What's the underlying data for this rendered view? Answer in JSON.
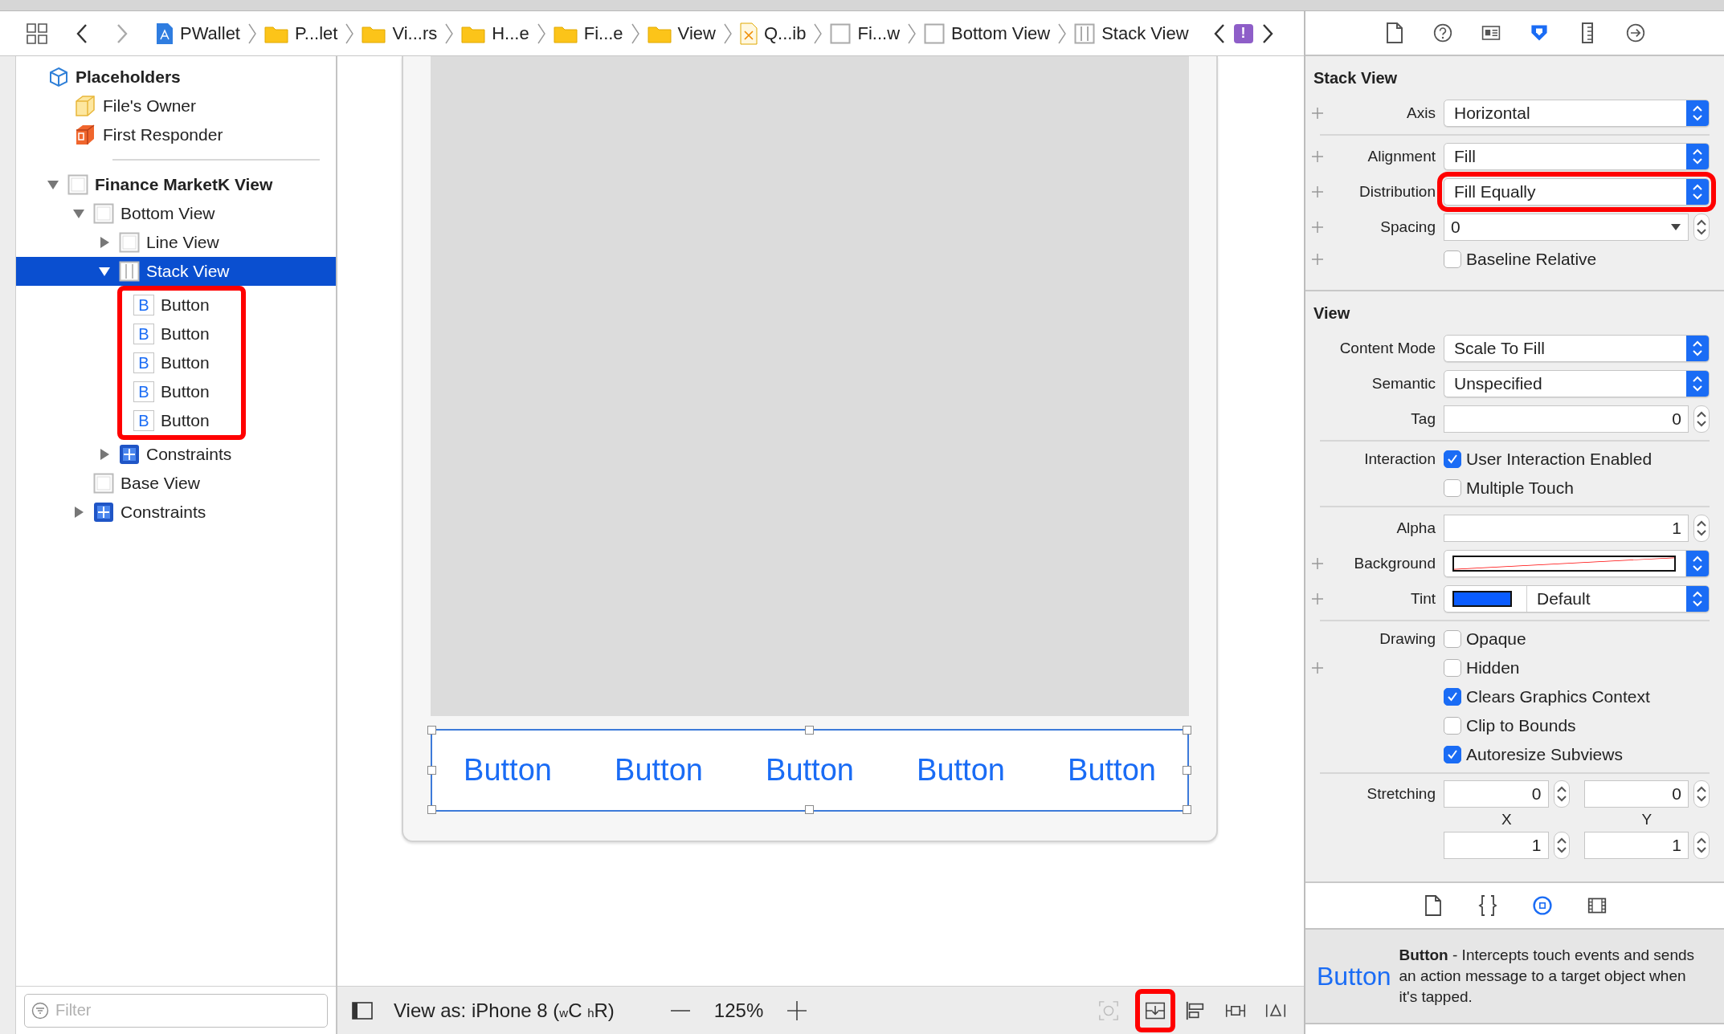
{
  "navigator": {
    "back_enabled": true,
    "forward_enabled": false
  },
  "breadcrumbs": [
    {
      "label": "PWallet",
      "kind": "project"
    },
    {
      "label": "P...let",
      "kind": "folder"
    },
    {
      "label": "Vi...rs",
      "kind": "folder"
    },
    {
      "label": "H...e",
      "kind": "folder"
    },
    {
      "label": "Fi...e",
      "kind": "folder"
    },
    {
      "label": "View",
      "kind": "folder"
    },
    {
      "label": "Q...ib",
      "kind": "xib"
    },
    {
      "label": "Fi...w",
      "kind": "view"
    },
    {
      "label": "Bottom View",
      "kind": "view"
    },
    {
      "label": "Stack View",
      "kind": "stack"
    }
  ],
  "issue_badge": "!",
  "placeholders": {
    "title": "Placeholders",
    "items": [
      {
        "label": "File's Owner",
        "kind": "owner",
        "selected": false
      },
      {
        "label": "First Responder",
        "kind": "responder",
        "selected": false
      }
    ]
  },
  "outline": [
    {
      "label": "Finance MarketK View",
      "kind": "view",
      "bold": true,
      "expanded": true,
      "selected": false,
      "children": [
        {
          "label": "Bottom View",
          "kind": "view",
          "expanded": true,
          "selected": false,
          "children": [
            {
              "label": "Line View",
              "kind": "view",
              "expanded": false,
              "selected": false
            },
            {
              "label": "Stack View",
              "kind": "stack",
              "expanded": true,
              "selected": true,
              "children_highlighted": true,
              "children": [
                {
                  "label": "Button",
                  "kind": "button",
                  "icon_text": "B",
                  "selected": false
                },
                {
                  "label": "Button",
                  "kind": "button",
                  "icon_text": "B",
                  "selected": false
                },
                {
                  "label": "Button",
                  "kind": "button",
                  "icon_text": "B",
                  "selected": false
                },
                {
                  "label": "Button",
                  "kind": "button",
                  "icon_text": "B",
                  "selected": false
                },
                {
                  "label": "Button",
                  "kind": "button",
                  "icon_text": "B",
                  "selected": false
                }
              ]
            },
            {
              "label": "Constraints",
              "kind": "constraints",
              "expanded": false,
              "selected": false
            }
          ]
        },
        {
          "label": "Base View",
          "kind": "view",
          "selected": false
        },
        {
          "label": "Constraints",
          "kind": "constraints",
          "expanded": false,
          "selected": false
        }
      ]
    }
  ],
  "filter": {
    "placeholder": "Filter"
  },
  "canvas": {
    "stack_buttons": [
      "Button",
      "Button",
      "Button",
      "Button",
      "Button"
    ]
  },
  "canvas_toolbar": {
    "view_as": "View as: iPhone 8 ($_{w}$C $_{h}$R)",
    "zoom": "125%",
    "tools": [
      {
        "kind": "update",
        "disabled": true,
        "highlighted": false
      },
      {
        "kind": "embed",
        "disabled": false,
        "highlighted": true
      },
      {
        "kind": "align",
        "disabled": false,
        "highlighted": false
      },
      {
        "kind": "pin",
        "disabled": false,
        "highlighted": false
      },
      {
        "kind": "resolve",
        "disabled": false,
        "highlighted": false
      }
    ]
  },
  "inspector_tabs": [
    {
      "kind": "file",
      "selected": false
    },
    {
      "kind": "help",
      "selected": false
    },
    {
      "kind": "identity",
      "selected": false
    },
    {
      "kind": "attributes",
      "selected": true
    },
    {
      "kind": "size",
      "selected": false
    },
    {
      "kind": "connections",
      "selected": false
    }
  ],
  "sections": [
    {
      "title": "Stack View",
      "groups": [
        [
          {
            "kind": "popup",
            "plus": true,
            "label": "Axis",
            "value": "Horizontal"
          }
        ],
        [
          {
            "kind": "popup",
            "plus": true,
            "label": "Alignment",
            "value": "Fill"
          },
          {
            "kind": "popup",
            "plus": true,
            "label": "Distribution",
            "value": "Fill Equally",
            "highlighted": true
          },
          {
            "kind": "combo",
            "plus": true,
            "label": "Spacing",
            "value": "0"
          },
          {
            "kind": "checkbox",
            "plus": true,
            "text": "Baseline Relative",
            "checked": false
          }
        ]
      ]
    },
    {
      "title": "View",
      "groups": [
        [
          {
            "kind": "popup",
            "label": "Content Mode",
            "value": "Scale To Fill"
          },
          {
            "kind": "popup",
            "label": "Semantic",
            "value": "Unspecified"
          },
          {
            "kind": "stepper",
            "label": "Tag",
            "value": "0"
          }
        ],
        [
          {
            "kind": "checkbox",
            "label": "Interaction",
            "text": "User Interaction Enabled",
            "checked": true
          },
          {
            "kind": "checkbox",
            "text": "Multiple Touch",
            "checked": false
          }
        ],
        [
          {
            "kind": "stepper",
            "label": "Alpha",
            "value": "1"
          },
          {
            "kind": "color",
            "plus": true,
            "label": "Background"
          },
          {
            "kind": "color",
            "plus": true,
            "label": "Tint",
            "color": "#0a5cff",
            "value": "Default"
          }
        ],
        [
          {
            "kind": "checkbox",
            "label": "Drawing",
            "text": "Opaque",
            "checked": false
          },
          {
            "kind": "checkbox",
            "plus": true,
            "text": "Hidden",
            "checked": false
          },
          {
            "kind": "checkbox",
            "text": "Clears Graphics Context",
            "checked": true
          },
          {
            "kind": "checkbox",
            "text": "Clip to Bounds",
            "checked": false
          },
          {
            "kind": "checkbox",
            "text": "Autoresize Subviews",
            "checked": true
          }
        ],
        [
          {
            "kind": "pair",
            "label": "Stretching",
            "fields": [
              {
                "value": "0",
                "caption": "X"
              },
              {
                "value": "0",
                "caption": "Y"
              }
            ]
          },
          {
            "kind": "pair",
            "fields": [
              {
                "value": "1"
              },
              {
                "value": "1"
              }
            ]
          }
        ]
      ]
    }
  ],
  "library_tabs": [
    {
      "kind": "file",
      "selected": false
    },
    {
      "kind": "code",
      "selected": false
    },
    {
      "kind": "object",
      "selected": true
    },
    {
      "kind": "media",
      "selected": false
    }
  ],
  "library_item": {
    "preview": "Button",
    "description": "**Button** - Intercepts touch events and sends an action message to a target object when it's tapped."
  }
}
